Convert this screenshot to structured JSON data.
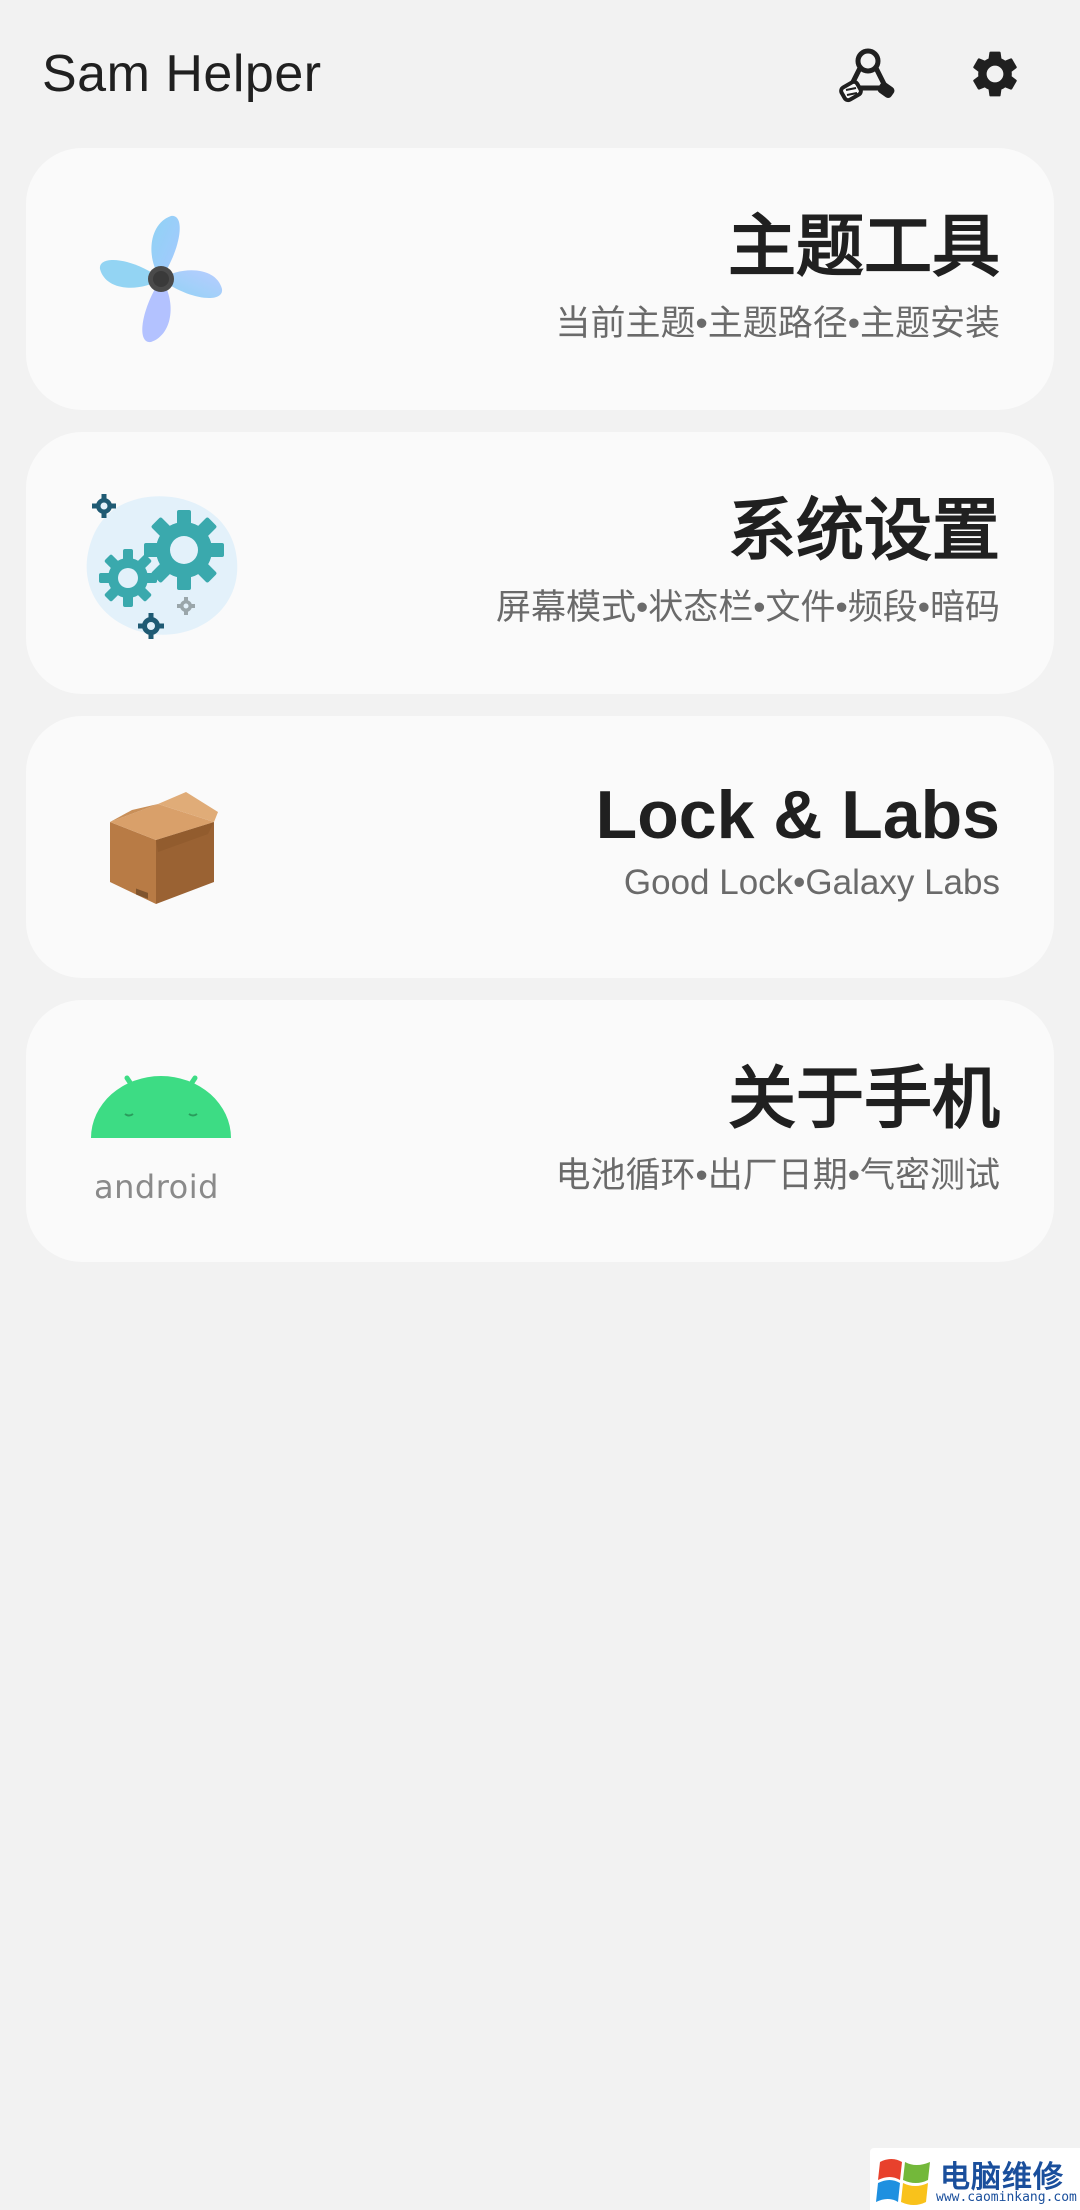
{
  "app": {
    "title": "Sam Helper"
  },
  "toolbar": {
    "actions": [
      {
        "icon": "connect-icon"
      },
      {
        "icon": "gear-icon"
      }
    ]
  },
  "cards": [
    {
      "title": "主题工具",
      "subtitle": "当前主题•主题路径•主题安装",
      "icon": "pinwheel-icon"
    },
    {
      "title": "系统设置",
      "subtitle": "屏幕模式•状态栏•文件•频段•暗码",
      "icon": "gears-icon"
    },
    {
      "title": "Lock & Labs",
      "subtitle": "Good Lock•Galaxy Labs",
      "icon": "box-icon"
    },
    {
      "title": "关于手机",
      "subtitle": "电池循环•出厂日期•气密测试",
      "icon": "android-icon",
      "icon_label": "android"
    }
  ],
  "watermark": {
    "title": "电脑维修",
    "url": "www.caominkang.com"
  },
  "colors": {
    "background": "#f2f2f2",
    "card": "#fafafa",
    "title": "#202020",
    "subtitle": "#6a6a6a",
    "android_green": "#3ddc84",
    "gear_teal": "#3aa9ad"
  }
}
